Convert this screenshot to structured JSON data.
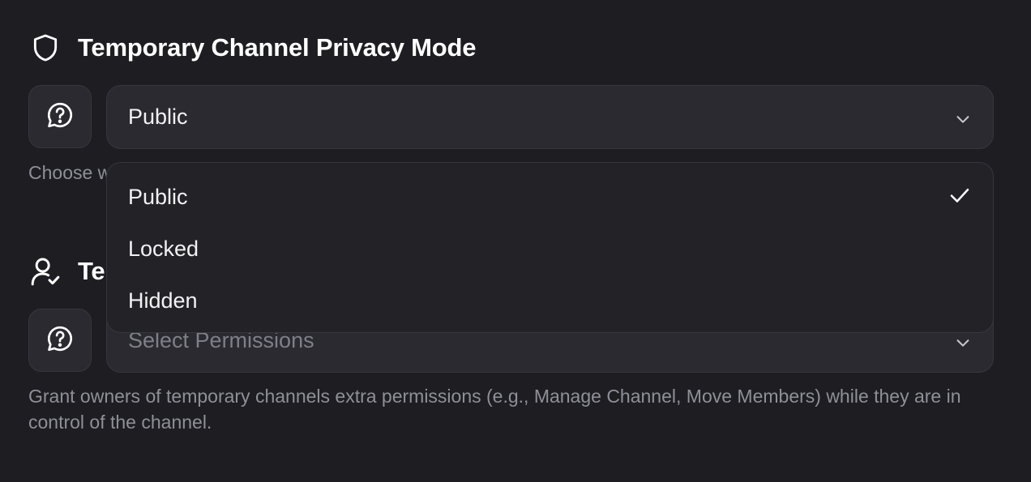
{
  "privacy": {
    "title": "Temporary Channel Privacy Mode",
    "selected_value": "Public",
    "help_text": "Choose w",
    "options": [
      {
        "label": "Public",
        "selected": true
      },
      {
        "label": "Locked",
        "selected": false
      },
      {
        "label": "Hidden",
        "selected": false
      }
    ]
  },
  "permissions": {
    "title": "Te",
    "placeholder": "Select Permissions",
    "help_text": "Grant owners of temporary channels extra permissions (e.g., Manage Channel, Move Members) while they are in control of the channel."
  },
  "icons": {
    "privacy_title": "shield-icon",
    "permissions_title": "user-check-icon",
    "help": "help-bubble-icon",
    "dropdown": "chevron-down-icon",
    "selected": "check-icon"
  },
  "colors": {
    "background": "#1d1d22",
    "field": "#2a2a30",
    "menu": "#222227",
    "border": "#36363d",
    "text": "#f2f2f4",
    "muted": "#8f8f98"
  }
}
